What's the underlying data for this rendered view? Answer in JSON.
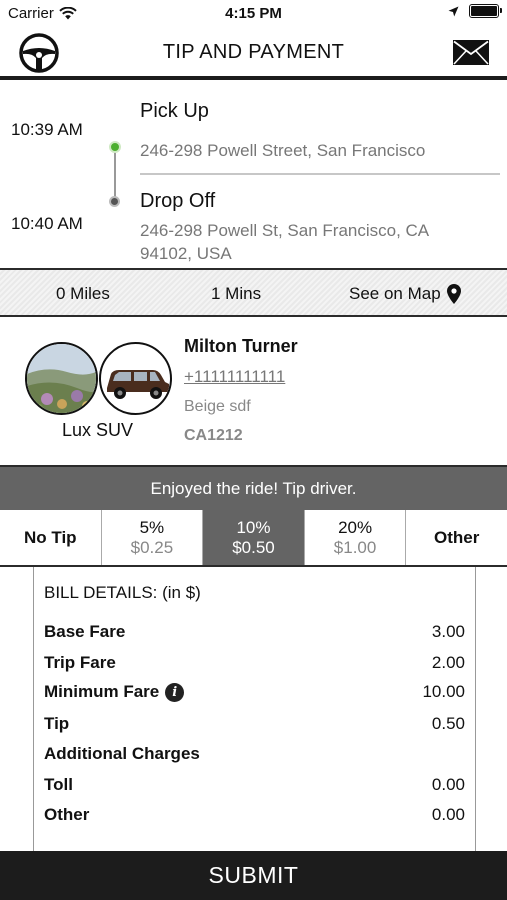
{
  "status_bar": {
    "carrier": "Carrier",
    "time": "4:15 PM"
  },
  "header": {
    "title": "TIP AND PAYMENT",
    "left_icon": "steering-wheel-icon",
    "right_icon": "mail-icon"
  },
  "trip": {
    "pickup_time": "10:39 AM",
    "dropoff_time": "10:40 AM",
    "pickup_label": "Pick Up",
    "pickup_address": "246-298 Powell Street, San Francisco",
    "dropoff_label": "Drop Off",
    "dropoff_address": "246-298 Powell St, San Francisco, CA 94102, USA"
  },
  "stats": {
    "miles": "0 Miles",
    "mins": "1 Mins",
    "map_link": "See on Map"
  },
  "driver": {
    "name": "Milton Turner",
    "phone": "+11111111111",
    "car": "Beige sdf",
    "plate": "CA1212",
    "vehicle_type": "Lux SUV"
  },
  "tip": {
    "banner": "Enjoyed the ride! Tip driver.",
    "options": [
      {
        "label": "No Tip"
      },
      {
        "pct": "5%",
        "amount": "$0.25"
      },
      {
        "pct": "10%",
        "amount": "$0.50",
        "selected": true
      },
      {
        "pct": "20%",
        "amount": "$1.00"
      },
      {
        "label": "Other"
      }
    ]
  },
  "bill": {
    "heading": "BILL DETAILS: (in  $)",
    "rows": [
      {
        "label": "Base Fare",
        "value": "3.00"
      },
      {
        "label": "Trip Fare",
        "value": "2.00"
      },
      {
        "label": "Minimum Fare",
        "value": "10.00"
      },
      {
        "label": "Tip",
        "value": "0.50"
      },
      {
        "label": "Additional Charges",
        "value": ""
      },
      {
        "label": "Toll",
        "value": "0.00"
      },
      {
        "label": "Other",
        "value": "0.00"
      }
    ]
  },
  "submit_label": "SUBMIT",
  "colors": {
    "selected_tip": "#646464",
    "header_bar": "#1c1c1c",
    "pickup_dot": "#4caf2f"
  }
}
